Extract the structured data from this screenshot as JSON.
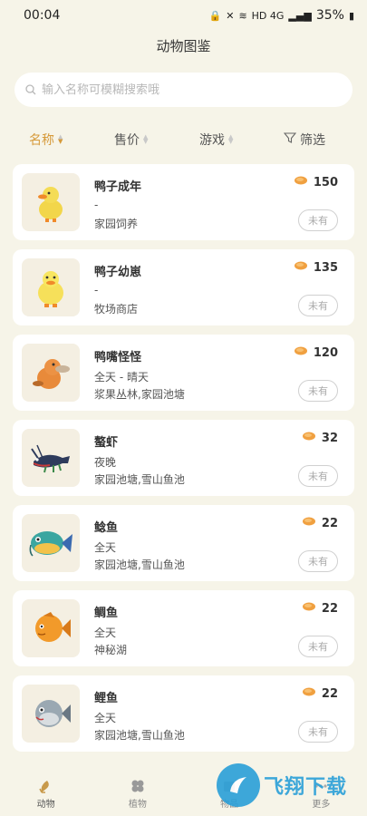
{
  "status": {
    "time": "00:04",
    "network": "HD 4G",
    "battery": "35%"
  },
  "page": {
    "title": "动物图鉴"
  },
  "search": {
    "placeholder": "输入名称可模糊搜索哦",
    "value": ""
  },
  "sort": {
    "name": "名称",
    "price": "售价",
    "game": "游戏",
    "filter": "筛选"
  },
  "items": [
    {
      "name": "鸭子成年",
      "time": "-",
      "location": "家园饲养",
      "price": "150",
      "owned": "未有",
      "icon": "duck-adult-icon"
    },
    {
      "name": "鸭子幼崽",
      "time": "-",
      "location": "牧场商店",
      "price": "135",
      "owned": "未有",
      "icon": "duckling-icon"
    },
    {
      "name": "鸭嘴怪怪",
      "time": "全天 - 晴天",
      "location": "浆果丛林,家园池塘",
      "price": "120",
      "owned": "未有",
      "icon": "platypus-icon"
    },
    {
      "name": "螯虾",
      "time": "夜晚",
      "location": "家园池塘,雪山鱼池",
      "price": "32",
      "owned": "未有",
      "icon": "crayfish-icon"
    },
    {
      "name": "鲶鱼",
      "time": "全天",
      "location": "家园池塘,雪山鱼池",
      "price": "22",
      "owned": "未有",
      "icon": "catfish-icon"
    },
    {
      "name": "鲷鱼",
      "time": "全天",
      "location": "神秘湖",
      "price": "22",
      "owned": "未有",
      "icon": "bream-icon"
    },
    {
      "name": "鲤鱼",
      "time": "全天",
      "location": "家园池塘,雪山鱼池",
      "price": "22",
      "owned": "未有",
      "icon": "carp-icon"
    }
  ],
  "tabs": [
    {
      "label": "动物",
      "icon": "fish-icon"
    },
    {
      "label": "植物",
      "icon": "clover-icon"
    },
    {
      "label": "物品",
      "icon": "item-icon"
    },
    {
      "label": "更多",
      "icon": "more-icon"
    }
  ],
  "watermark": {
    "text": "飞翔下载"
  },
  "colors": {
    "accent": "#d69a3a",
    "background": "#f6f4e8",
    "card": "#ffffff",
    "coin": "#f0a040"
  }
}
